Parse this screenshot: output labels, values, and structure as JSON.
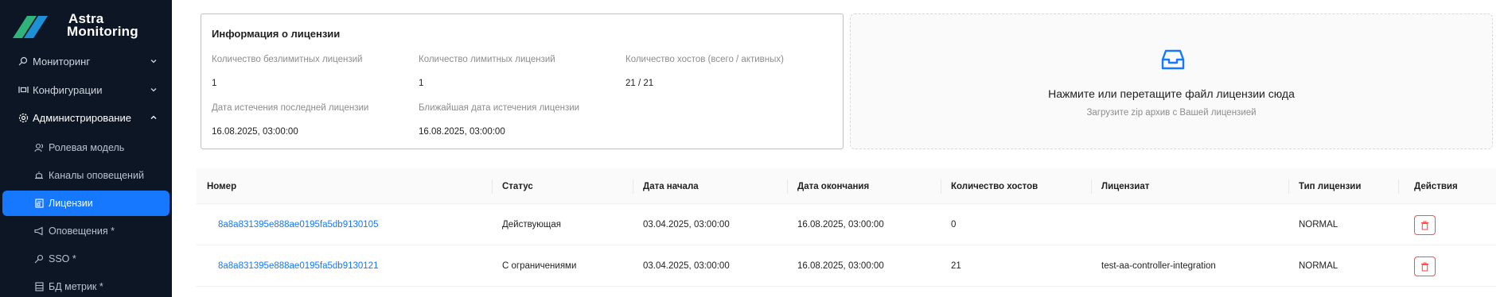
{
  "brand": {
    "line1": "Astra",
    "line2": "Monitoring",
    "logo": "astra-logo"
  },
  "sidebar": {
    "items": [
      {
        "label": "Мониторинг",
        "icon": "monitoring-icon",
        "expanded": false
      },
      {
        "label": "Конфигурации",
        "icon": "config-icon",
        "expanded": false
      },
      {
        "label": "Администрирование",
        "icon": "gear-icon",
        "expanded": true
      }
    ],
    "subitems": [
      {
        "label": "Ролевая модель",
        "icon": "users-icon"
      },
      {
        "label": "Каналы оповещений",
        "icon": "bell-icon"
      },
      {
        "label": "Лицензии",
        "icon": "license-icon",
        "active": true
      },
      {
        "label": "Оповещения *",
        "icon": "megaphone-icon"
      },
      {
        "label": "SSO *",
        "icon": "key-icon"
      },
      {
        "label": "БД метрик *",
        "icon": "database-icon"
      }
    ]
  },
  "license_info": {
    "title": "Информация о лицензии",
    "fields": [
      {
        "label": "Количество безлимитных лицензий",
        "value": "1"
      },
      {
        "label": "Количество лимитных лицензий",
        "value": "1"
      },
      {
        "label": "Количество хостов (всего / активных)",
        "value": "21 / 21"
      },
      {
        "label": "Дата истечения последней лицензии",
        "value": "16.08.2025, 03:00:00"
      },
      {
        "label": "Ближайшая дата истечения лицензии",
        "value": "16.08.2025, 03:00:00"
      }
    ]
  },
  "upload": {
    "title": "Нажмите или перетащите файл лицензии сюда",
    "hint": "Загрузите zip архив с Вашей лицензией",
    "icon": "inbox-icon"
  },
  "table": {
    "columns": [
      "Номер",
      "Статус",
      "Дата начала",
      "Дата окончания",
      "Количество хостов",
      "Лицензиат",
      "Тип лицензии",
      "Действия"
    ],
    "rows": [
      {
        "number": "8a8a831395e888ae0195fa5db9130105",
        "status": "Действующая",
        "start": "03.04.2025, 03:00:00",
        "end": "16.08.2025, 03:00:00",
        "hosts": "0",
        "licensee": "",
        "type": "NORMAL"
      },
      {
        "number": "8a8a831395e888ae0195fa5db9130121",
        "status": "С ограничениями",
        "start": "03.04.2025, 03:00:00",
        "end": "16.08.2025, 03:00:00",
        "hosts": "21",
        "licensee": "test-aa-controller-integration",
        "type": "NORMAL"
      }
    ]
  },
  "colors": {
    "sidebar_bg": "#0d1624",
    "accent": "#1677ff",
    "danger": "#ff4d4f",
    "logo_green": "#2fb37a"
  }
}
